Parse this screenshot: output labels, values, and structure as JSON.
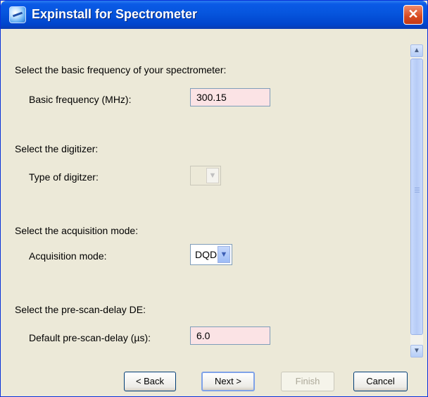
{
  "window": {
    "title": "Expinstall for Spectrometer",
    "close_label": "✕"
  },
  "sections": [
    {
      "heading": "Select the basic frequency of your spectrometer:",
      "field_label": "Basic frequency (MHz):",
      "value": "300.15"
    },
    {
      "heading": "Select the digitizer:",
      "field_label": "Type of digitzer:",
      "value": ""
    },
    {
      "heading": "Select the acquisition mode:",
      "field_label": "Acquisition mode:",
      "value": "DQD"
    },
    {
      "heading": "Select the pre-scan-delay DE:",
      "field_label": "Default pre-scan-delay (µs):",
      "value": "6.0"
    }
  ],
  "buttons": {
    "back": "< Back",
    "next": "Next >",
    "finish": "Finish",
    "cancel": "Cancel"
  },
  "icons": {
    "app": "spectrometer-app-icon",
    "scroll_up": "chevron-up-icon",
    "scroll_down": "chevron-down-icon",
    "combo_arrow": "chevron-down-icon"
  },
  "colors": {
    "title_bar": "#0655dd",
    "field_background": "#fbe3e5",
    "close_button": "#d84a20"
  }
}
